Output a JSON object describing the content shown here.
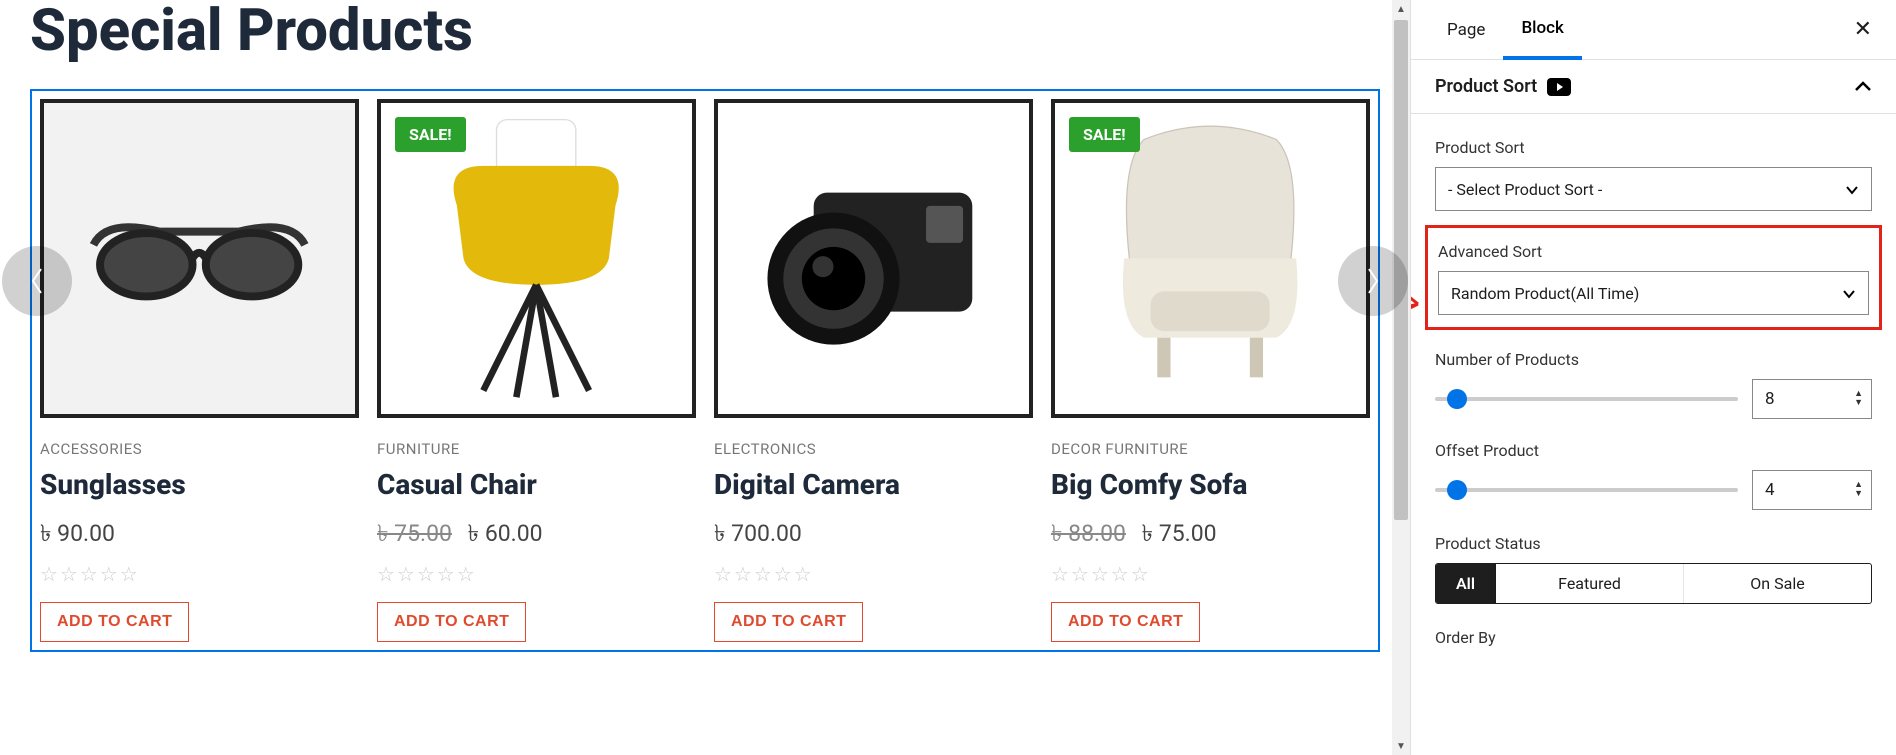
{
  "page": {
    "title": "Special Products"
  },
  "products": [
    {
      "category": "ACCESSORIES",
      "name": "Sunglasses",
      "price_cur": "৳ 90.00",
      "price_old": "",
      "sale": false,
      "cart": "ADD TO CART"
    },
    {
      "category": "FURNITURE",
      "name": "Casual Chair",
      "price_cur": "৳ 60.00",
      "price_old": "৳ 75.00",
      "sale": true,
      "cart": "ADD TO CART"
    },
    {
      "category": "ELECTRONICS",
      "name": "Digital Camera",
      "price_cur": "৳ 700.00",
      "price_old": "",
      "sale": false,
      "cart": "ADD TO CART"
    },
    {
      "category": "DECOR  FURNITURE",
      "name": "Big Comfy Sofa",
      "price_cur": "৳ 75.00",
      "price_old": "৳ 88.00",
      "sale": true,
      "cart": "ADD TO CART"
    }
  ],
  "sale_label": "SALE!",
  "sidebar": {
    "tabs": {
      "page": "Page",
      "block": "Block"
    },
    "panel_title": "Product Sort",
    "product_sort_label": "Product Sort",
    "product_sort_value": "- Select Product Sort -",
    "advanced_sort_label": "Advanced Sort",
    "advanced_sort_value": "Random Product(All Time)",
    "num_products_label": "Number of Products",
    "num_products_value": "8",
    "offset_label": "Offset Product",
    "offset_value": "4",
    "status_label": "Product Status",
    "status_opts": {
      "all": "All",
      "featured": "Featured",
      "onsale": "On Sale"
    },
    "orderby_label": "Order By"
  }
}
